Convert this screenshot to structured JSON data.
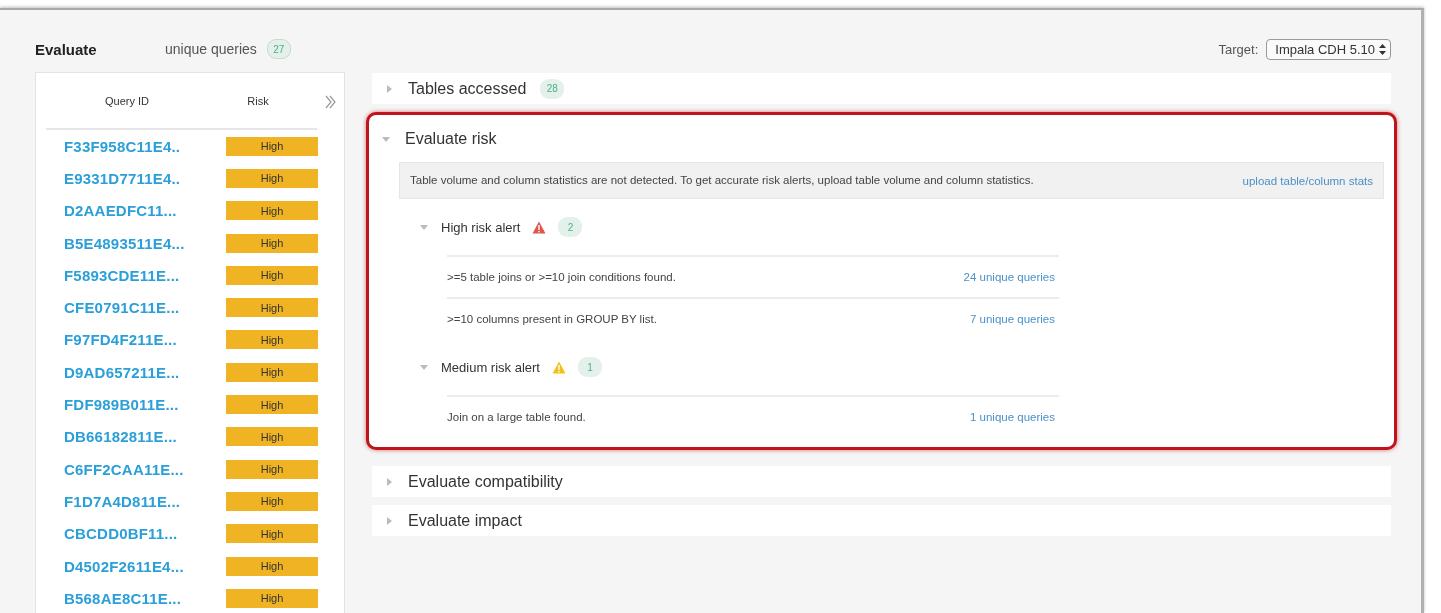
{
  "header": {
    "title": "Evaluate",
    "count_label": "unique queries",
    "count": "27",
    "target_label": "Target:",
    "target_value": "Impala CDH 5.10"
  },
  "query_table": {
    "columns": [
      "Query ID",
      "Risk"
    ],
    "rows": [
      {
        "query_id": "F33F958C11E4..",
        "risk": "High"
      },
      {
        "query_id": "E9331D7711E4..",
        "risk": "High"
      },
      {
        "query_id": "D2AAEDFC11...",
        "risk": "High"
      },
      {
        "query_id": "B5E4893511E4...",
        "risk": "High"
      },
      {
        "query_id": "F5893CDE11E...",
        "risk": "High"
      },
      {
        "query_id": "CFE0791C11E...",
        "risk": "High"
      },
      {
        "query_id": "F97FD4F211E...",
        "risk": "High"
      },
      {
        "query_id": "D9AD657211E...",
        "risk": "High"
      },
      {
        "query_id": "FDF989B011E...",
        "risk": "High"
      },
      {
        "query_id": "DB66182811E...",
        "risk": "High"
      },
      {
        "query_id": "C6FF2CAA11E...",
        "risk": "High"
      },
      {
        "query_id": "F1D7A4D811E...",
        "risk": "High"
      },
      {
        "query_id": "CBCDD0BF11...",
        "risk": "High"
      },
      {
        "query_id": "D4502F2611E4...",
        "risk": "High"
      },
      {
        "query_id": "B568AE8C11E...",
        "risk": "High"
      }
    ]
  },
  "sections": [
    {
      "title": "Tables accessed",
      "count": "28",
      "expanded": false,
      "highlighted": false
    },
    {
      "title": "Evaluate risk",
      "expanded": true,
      "highlighted": true,
      "notice": {
        "text": "Table volume and column statistics are not detected. To get accurate risk alerts, upload table volume and column statistics.",
        "link": "upload table/column stats"
      },
      "alerts": [
        {
          "title": "High risk alert",
          "kind": "high",
          "count": "2",
          "expanded": true,
          "items": [
            {
              "text": ">=5 table joins or >=10 join conditions found.",
              "link": "24 unique queries"
            },
            {
              "text": ">=10 columns present in GROUP BY list.",
              "link": "7 unique queries"
            }
          ]
        },
        {
          "title": "Medium risk alert",
          "kind": "medium",
          "count": "1",
          "expanded": true,
          "items": [
            {
              "text": "Join on a large table found.",
              "link": "1 unique queries"
            }
          ]
        }
      ]
    },
    {
      "title": "Evaluate compatibility",
      "expanded": false,
      "highlighted": false
    },
    {
      "title": "Evaluate impact",
      "expanded": false,
      "highlighted": false
    }
  ]
}
